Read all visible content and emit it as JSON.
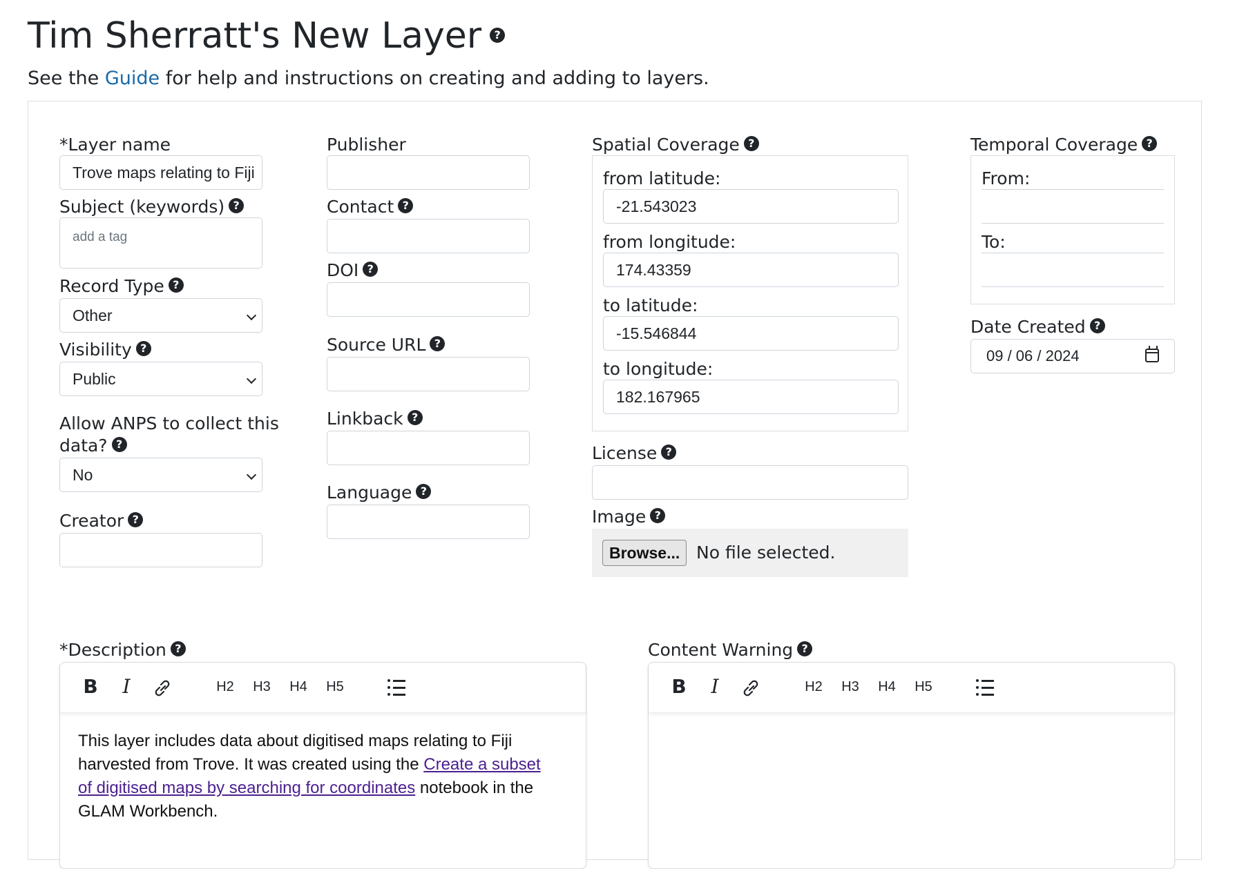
{
  "page": {
    "title": "Tim Sherratt's New Layer",
    "subtitle_before": "See the ",
    "subtitle_link": "Guide",
    "subtitle_after": " for help and instructions on creating and adding to layers."
  },
  "col1": {
    "layer_name_label": "*Layer name",
    "layer_name_value": "Trove maps relating to Fiji",
    "subject_label": "Subject (keywords)",
    "subject_placeholder": "add a tag",
    "record_type_label": "Record Type",
    "record_type_value": "Other",
    "visibility_label": "Visibility",
    "visibility_value": "Public",
    "anps_label_line1": "Allow ANPS to collect this",
    "anps_label_line2": "data?",
    "anps_value": "No",
    "creator_label": "Creator",
    "creator_value": ""
  },
  "col2": {
    "publisher_label": "Publisher",
    "contact_label": "Contact",
    "doi_label": "DOI",
    "source_url_label": "Source URL",
    "linkback_label": "Linkback",
    "language_label": "Language"
  },
  "spatial": {
    "label": "Spatial Coverage",
    "from_lat_label": "from latitude:",
    "from_lat_value": "-21.543023",
    "from_lon_label": "from longitude:",
    "from_lon_value": "174.43359",
    "to_lat_label": "to latitude:",
    "to_lat_value": "-15.546844",
    "to_lon_label": "to longitude:",
    "to_lon_value": "182.167965",
    "license_label": "License",
    "image_label": "Image",
    "browse_label": "Browse...",
    "file_status": "No file selected."
  },
  "temporal": {
    "label": "Temporal Coverage",
    "from_label": "From:",
    "to_label": "To:",
    "date_created_label": "Date Created",
    "date_created_value": "09 / 06 / 2024"
  },
  "description": {
    "label": "*Description",
    "text_before": "This layer includes data about digitised maps relating to Fiji harvested from Trove. It was created using the ",
    "link_text": "Create a subset of digitised maps by searching for coordinates",
    "text_after": " notebook in the GLAM Workbench."
  },
  "content_warning": {
    "label": "Content Warning"
  },
  "toolbar": {
    "bold": "B",
    "italic": "I",
    "h2": "H2",
    "h3": "H3",
    "h4": "H4",
    "h5": "H5"
  },
  "icons": {
    "help": "?"
  }
}
